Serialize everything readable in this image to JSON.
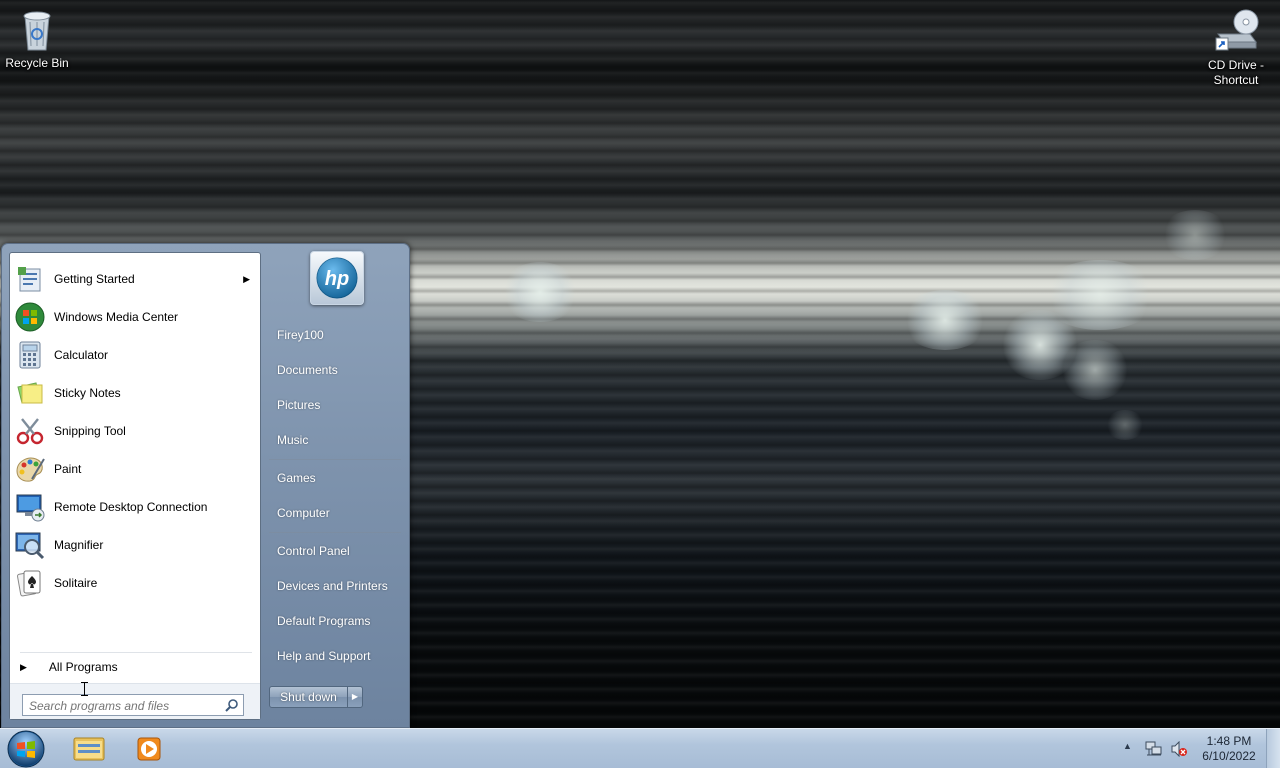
{
  "desktop": {
    "icons": [
      {
        "label": "Recycle Bin",
        "icon": "recycle-bin-icon"
      },
      {
        "label": "CD Drive -\nShortcut",
        "label_line1": "CD Drive -",
        "label_line2": "Shortcut",
        "icon": "cd-drive-shortcut-icon"
      }
    ]
  },
  "start_menu": {
    "pinned_programs": [
      {
        "label": "Getting Started",
        "icon": "getting-started-icon",
        "has_submenu": true
      },
      {
        "label": "Windows Media Center",
        "icon": "windows-media-center-icon"
      },
      {
        "label": "Calculator",
        "icon": "calculator-icon"
      },
      {
        "label": "Sticky Notes",
        "icon": "sticky-notes-icon"
      },
      {
        "label": "Snipping Tool",
        "icon": "snipping-tool-icon"
      },
      {
        "label": "Paint",
        "icon": "paint-icon"
      },
      {
        "label": "Remote Desktop Connection",
        "icon": "remote-desktop-icon"
      },
      {
        "label": "Magnifier",
        "icon": "magnifier-icon"
      },
      {
        "label": "Solitaire",
        "icon": "solitaire-icon"
      }
    ],
    "all_programs_label": "All Programs",
    "search_placeholder": "Search programs and files",
    "user_picture_text": "hp",
    "right_items": [
      {
        "label": "Firey100"
      },
      {
        "label": "Documents"
      },
      {
        "label": "Pictures"
      },
      {
        "label": "Music"
      },
      {
        "label": "Games"
      },
      {
        "label": "Computer"
      },
      {
        "label": "Control Panel"
      },
      {
        "label": "Devices and Printers"
      },
      {
        "label": "Default Programs"
      },
      {
        "label": "Help and Support"
      }
    ],
    "shutdown_label": "Shut down"
  },
  "taskbar": {
    "pinned": [
      {
        "icon": "windows-explorer-icon"
      },
      {
        "icon": "windows-media-player-icon"
      }
    ],
    "clock_time": "1:48 PM",
    "clock_date": "6/10/2022"
  },
  "colors": {
    "start_menu_frame": "#7e93ad",
    "taskbar": "#b1c5dc"
  }
}
